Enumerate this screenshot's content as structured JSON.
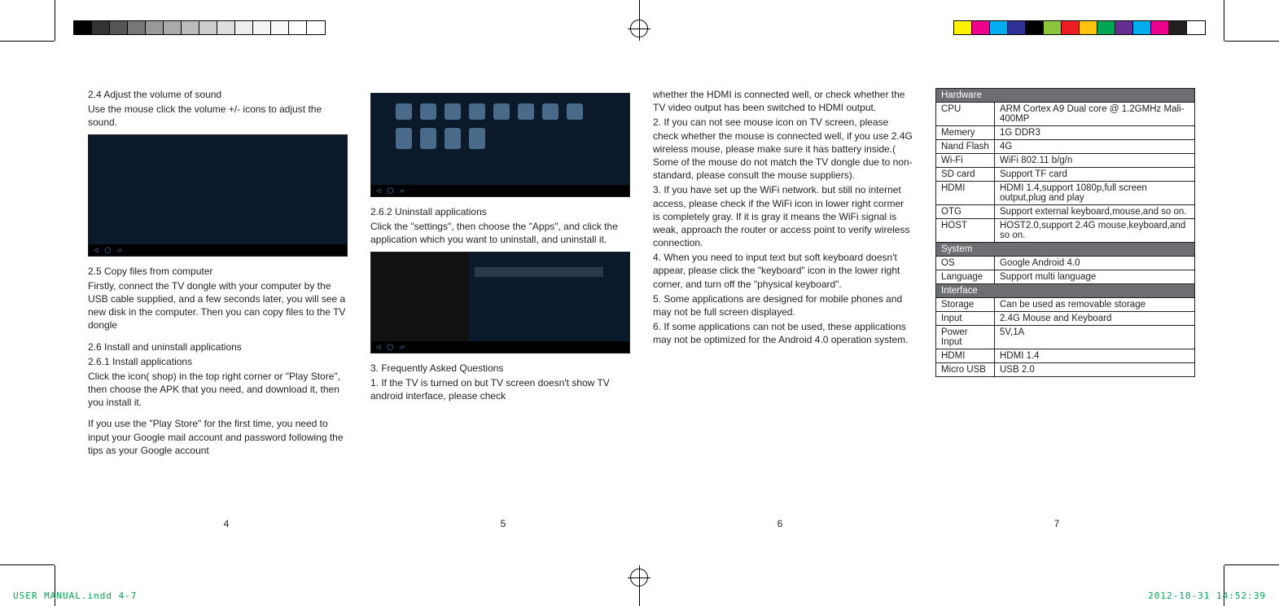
{
  "page4": {
    "s24_title": "2.4 Adjust the volume of sound",
    "s24_body": "Use the mouse click the volume +/- icons to adjust the sound.",
    "s25_title": "2.5 Copy files from computer",
    "s25_body": "Firstly, connect the TV dongle with your computer by the USB cable supplied, and a few seconds later, you will see a new disk in the computer. Then you can copy files to the TV dongle",
    "s26_title": "2.6 Install and uninstall applications",
    "s261_title": "2.6.1 Install applications",
    "s261_body": "Click the icon( shop) in the top right corner or \"Play Store\", then choose the APK that you need, and download it, then you install it.",
    "s261_note": "If you use the \"Play Store\" for the first time, you need to input your Google mail account and password following the tips as your Google account",
    "num": "4"
  },
  "page5": {
    "s262_title": "2.6.2 Uninstall applications",
    "s262_body": "Click the \"settings\", then choose the \"Apps\", and click the application which you want to uninstall, and uninstall it.",
    "s3_title": "3. Frequently Asked Questions",
    "s3_q1": "1. If the TV is turned on but TV screen doesn't show TV android interface, please check",
    "num": "5"
  },
  "page6": {
    "cont1": "whether the HDMI is connected well, or check whether the TV video output has been switched to HDMI output.",
    "q2": "2. If you can not see mouse icon on TV screen, please check whether the mouse is connected well, if you use 2.4G wireless mouse, please make sure it has battery inside.( Some of the mouse do not match the TV dongle due to non-standard, please consult the mouse suppliers).",
    "q3": "3. If you have set up the WiFi network. but still no internet access, please check if the WiFi icon in lower right cormer is completely gray. If it is gray it means the WiFi signal is weak, approach the router or access point to verify wireless connection.",
    "q4": "4. When you need to input text but soft keyboard doesn't appear, please click the \"keyboard\" icon  in the lower right corner, and turn off the \"physical keyboard\".",
    "q5": "5. Some applications are designed for mobile phones and may not be full screen displayed.",
    "q6": "6. If some applications can not be used, these applications may not be optimized for the Android 4.0 operation system.",
    "num": "6"
  },
  "page7": {
    "num": "7",
    "sections": {
      "hardware": "Hardware",
      "system": "System",
      "interface": "Interface"
    },
    "rows": {
      "cpu_k": "CPU",
      "cpu_v": "ARM Cortex A9 Dual core @ 1.2GMHz Mali-400MP",
      "mem_k": "Memery",
      "mem_v": "1G DDR3",
      "nand_k": "Nand Flash",
      "nand_v": "4G",
      "wifi_k": "Wi-Fi",
      "wifi_v": "WiFi 802.11 b/g/n",
      "sd_k": "SD card",
      "sd_v": "Support TF card",
      "hdmi_k": "HDMI",
      "hdmi_v": "HDMI 1.4,support 1080p,full screen output,plug and play",
      "otg_k": "OTG",
      "otg_v": "Support external keyboard,mouse,and so on.",
      "host_k": "HOST",
      "host_v": "HOST2.0,support 2.4G mouse,keyboard,and so on.",
      "os_k": "OS",
      "os_v": "Google Android 4.0",
      "lang_k": "Language",
      "lang_v": "Support multi language",
      "stor_k": "Storage",
      "stor_v": "Can be used as removable storage",
      "input_k": "Input",
      "input_v": "2.4G Mouse and Keyboard",
      "pwr_k": "Power Input",
      "pwr_v": "5V,1A",
      "hdmi2_k": "HDMI",
      "hdmi2_v": "HDMI 1.4",
      "usb_k": "Micro USB",
      "usb_v": "USB 2.0"
    }
  },
  "footer": {
    "file": "USER MANUAL.indd   4-7",
    "date": "2012-10-31   14:52:39"
  },
  "colorbars": {
    "left": [
      "#000",
      "#333",
      "#555",
      "#777",
      "#999",
      "#aaa",
      "#bbb",
      "#ccc",
      "#ddd",
      "#eee",
      "#f5f5f5",
      "#fafafa",
      "#fff",
      "#fff"
    ],
    "right": [
      "#fff200",
      "#ec008c",
      "#00aeef",
      "#2e3192",
      "#000",
      "#8dc63e",
      "#ed1c24",
      "#ffc20e",
      "#00a651",
      "#662d91",
      "#00adee",
      "#ec008b",
      "#231f20",
      "#fff"
    ]
  }
}
